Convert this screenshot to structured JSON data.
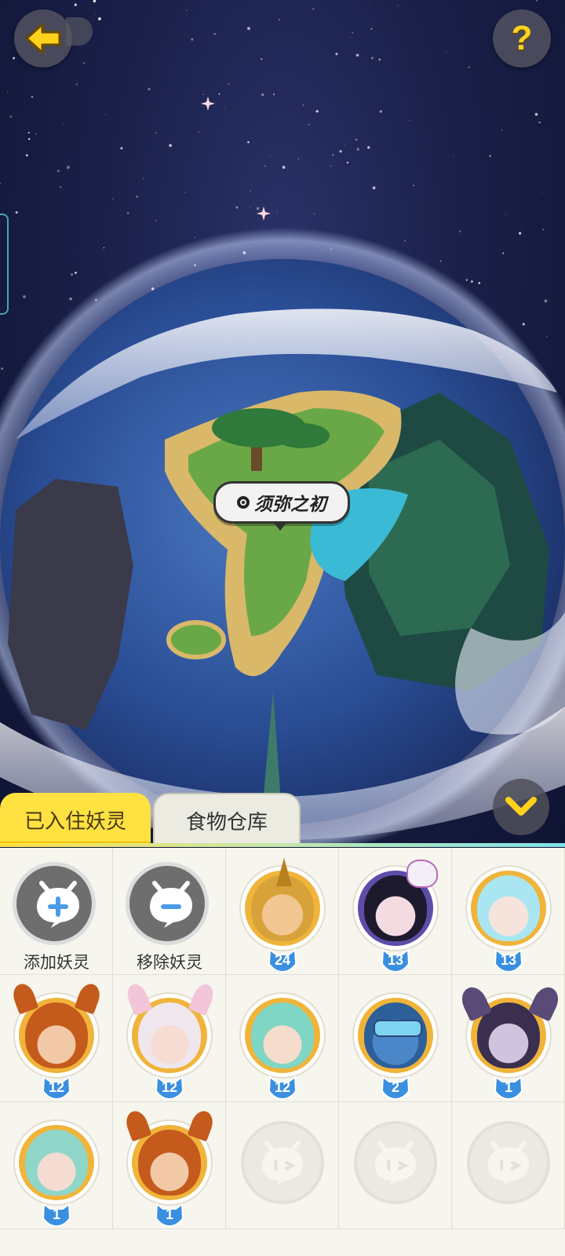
{
  "header": {
    "back_icon": "arrow-left-icon",
    "help_icon": "question-mark-icon",
    "help_text": "?"
  },
  "map": {
    "location_name": "须弥之初",
    "location_icon": "map-pin-icon"
  },
  "collapse": {
    "icon": "chevron-down-icon"
  },
  "tabs": [
    {
      "label": "已入住妖灵",
      "active": true
    },
    {
      "label": "食物仓库",
      "active": false
    }
  ],
  "actions": {
    "add": {
      "label": "添加妖灵",
      "icon": "plus-bubble-icon"
    },
    "remove": {
      "label": "移除妖灵",
      "icon": "minus-bubble-icon"
    }
  },
  "residents": [
    {
      "level": "24",
      "avatar": "golden-horned-boy-avatar"
    },
    {
      "level": "13",
      "avatar": "dark-haired-masked-girl-avatar"
    },
    {
      "level": "13",
      "avatar": "ice-blue-dragon-girl-avatar"
    },
    {
      "level": "12",
      "avatar": "orange-fox-boy-avatar"
    },
    {
      "level": "12",
      "avatar": "white-haired-fox-girl-avatar"
    },
    {
      "level": "12",
      "avatar": "mint-haired-boy-avatar"
    },
    {
      "level": "2",
      "avatar": "blue-beast-goggles-avatar"
    },
    {
      "level": "1",
      "avatar": "purple-bat-girl-avatar"
    },
    {
      "level": "1",
      "avatar": "teal-haired-girl-avatar"
    },
    {
      "level": "1",
      "avatar": "orange-fox-boy-avatar"
    }
  ],
  "empty_slot_icon": "empty-slot-face-icon",
  "colors": {
    "tab_active": "#ffe142",
    "badge": "#3a8fe0",
    "ring_gold": "#f0b43a"
  }
}
